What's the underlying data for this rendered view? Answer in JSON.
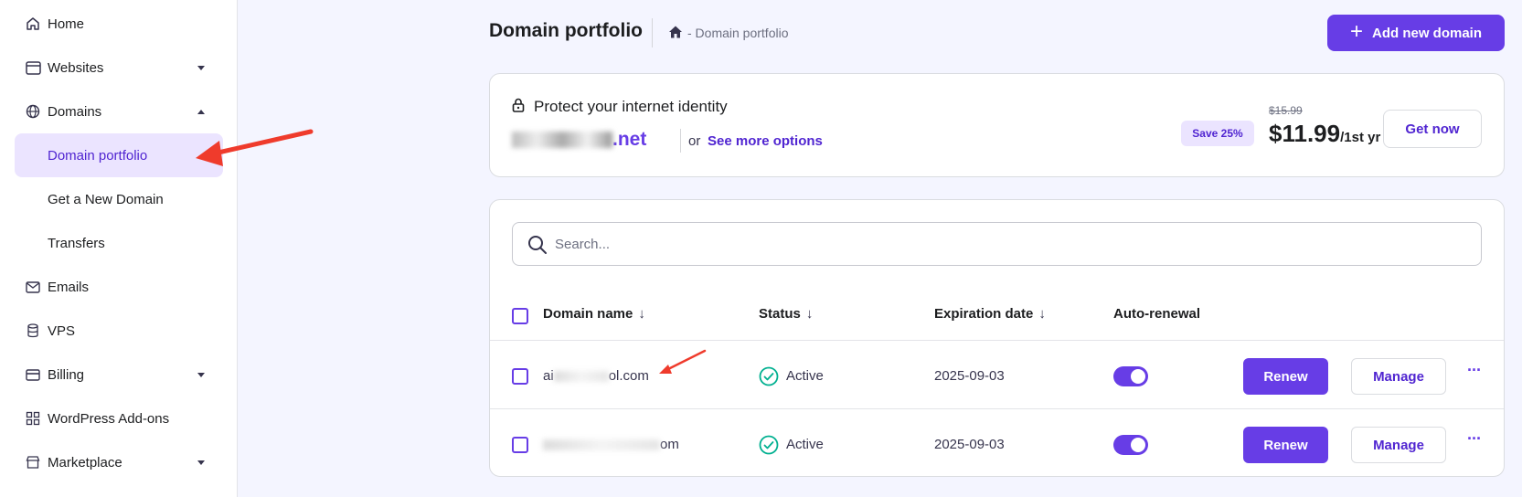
{
  "sidebar": {
    "items": [
      {
        "label": "Home",
        "icon": "home-icon"
      },
      {
        "label": "Websites",
        "icon": "browser-icon"
      },
      {
        "label": "Domains",
        "icon": "globe-icon"
      },
      {
        "label": "Domain portfolio"
      },
      {
        "label": "Get a New Domain"
      },
      {
        "label": "Transfers"
      },
      {
        "label": "Emails",
        "icon": "mail-icon"
      },
      {
        "label": "VPS",
        "icon": "server-icon"
      },
      {
        "label": "Billing",
        "icon": "card-icon"
      },
      {
        "label": "WordPress Add-ons",
        "icon": "addons-icon"
      },
      {
        "label": "Marketplace",
        "icon": "store-icon"
      }
    ]
  },
  "header": {
    "title": "Domain portfolio",
    "breadcrumb": "- Domain portfolio",
    "add_button": "Add new domain"
  },
  "promo": {
    "title": "Protect your internet identity",
    "domain_tld": ".net",
    "or_text": "or",
    "more_link": "See more options",
    "save_badge": "Save 25%",
    "old_price": "$15.99",
    "new_price": "$11.99",
    "per_period": "/1st yr",
    "cta": "Get now"
  },
  "search": {
    "placeholder": "Search..."
  },
  "table": {
    "columns": [
      "Domain name",
      "Status",
      "Expiration date",
      "Auto-renewal"
    ],
    "rows": [
      {
        "domain_prefix": "ai",
        "domain_suffix": "ol.com",
        "status": "Active",
        "expiration": "2025-09-03",
        "auto_renewal": true,
        "renew": "Renew",
        "manage": "Manage"
      },
      {
        "domain_prefix": "",
        "domain_suffix": "om",
        "status": "Active",
        "expiration": "2025-09-03",
        "auto_renewal": true,
        "renew": "Renew",
        "manage": "Manage"
      }
    ]
  },
  "colors": {
    "accent": "#673de6",
    "active_bg": "#ebe4ff",
    "success": "#00b090",
    "annotation": "#ef3b2c"
  }
}
